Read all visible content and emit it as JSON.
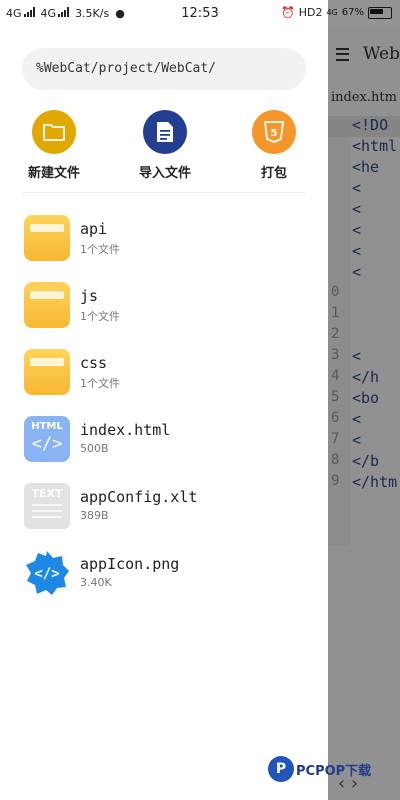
{
  "status_bar": {
    "net1": "4G",
    "net2": "4G",
    "speed": "3.5K/s",
    "time": "12:53",
    "hd": "HD2",
    "net3": "4G",
    "battery": "67%"
  },
  "editor": {
    "title": "Web",
    "file_tab": "index.htm",
    "lines": [
      {
        "num": "",
        "code": "<!DO"
      },
      {
        "num": "",
        "code": "<html"
      },
      {
        "num": "",
        "code": "  <he"
      },
      {
        "num": "",
        "code": "    <"
      },
      {
        "num": "",
        "code": "    <"
      },
      {
        "num": "",
        "code": "    <"
      },
      {
        "num": "",
        "code": "    <"
      },
      {
        "num": "",
        "code": "    <"
      },
      {
        "num": "0",
        "code": ""
      },
      {
        "num": "1",
        "code": ""
      },
      {
        "num": "2",
        "code": ""
      },
      {
        "num": "3",
        "code": "    <"
      },
      {
        "num": "4",
        "code": "  </h"
      },
      {
        "num": "5",
        "code": "  <bo"
      },
      {
        "num": "6",
        "code": "    <"
      },
      {
        "num": "7",
        "code": "    <"
      },
      {
        "num": "8",
        "code": "  </b"
      },
      {
        "num": "9",
        "code": "</htm"
      }
    ]
  },
  "drawer": {
    "path": "%WebCat/project/WebCat/",
    "actions": [
      {
        "label": "新建文件",
        "icon": "folder-icon",
        "color": "#e0a800"
      },
      {
        "label": "导入文件",
        "icon": "document-icon",
        "color": "#243f8f"
      },
      {
        "label": "打包",
        "icon": "html5-icon",
        "color": "#f5962a"
      }
    ],
    "files": [
      {
        "name": "api",
        "meta": "1个文件",
        "type": "folder"
      },
      {
        "name": "js",
        "meta": "1个文件",
        "type": "folder"
      },
      {
        "name": "css",
        "meta": "1个文件",
        "type": "folder"
      },
      {
        "name": "index.html",
        "meta": "500B",
        "type": "html",
        "icon_text": "HTML",
        "icon_code": "</>"
      },
      {
        "name": "appConfig.xlt",
        "meta": "389B",
        "type": "text",
        "icon_text": "TEXT"
      },
      {
        "name": "appIcon.png",
        "meta": "3.40K",
        "type": "image"
      }
    ]
  },
  "watermark": {
    "text": "PCPOP下载",
    "logo": "P"
  }
}
